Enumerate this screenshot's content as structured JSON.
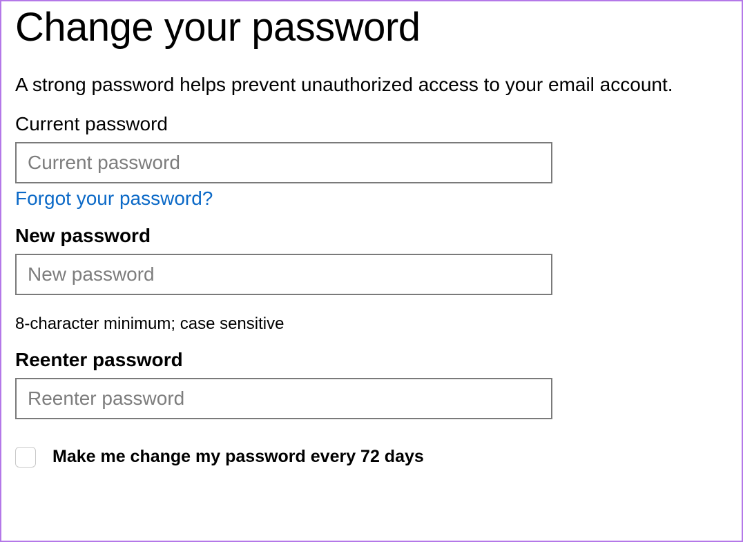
{
  "title": "Change your password",
  "description": "A strong password helps prevent unauthorized access to your email account.",
  "currentPassword": {
    "label": "Current password",
    "placeholder": "Current password",
    "value": ""
  },
  "forgotLink": "Forgot your password?",
  "newPassword": {
    "label": "New password",
    "placeholder": "New password",
    "value": ""
  },
  "passwordHint": "8-character minimum; case sensitive",
  "reenterPassword": {
    "label": "Reenter password",
    "placeholder": "Reenter password",
    "value": ""
  },
  "checkbox": {
    "label": "Make me change my password every 72 days",
    "checked": false
  }
}
